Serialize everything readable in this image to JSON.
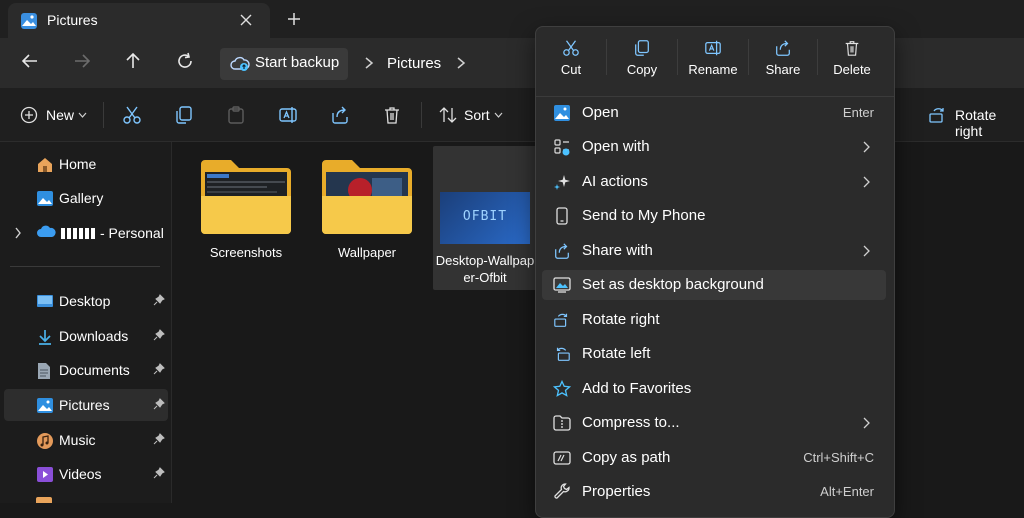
{
  "window": {
    "tab_title": "Pictures",
    "new_tab_symbol": "+"
  },
  "address": {
    "breadcrumbs": [
      "Start backup",
      "Pictures"
    ]
  },
  "toolbar": {
    "new_label": "New",
    "sort_label": "Sort",
    "rotate_right_label": "Rotate right"
  },
  "sidebar": {
    "top_items": [
      {
        "label": "Home",
        "icon": "home-icon"
      },
      {
        "label": "Gallery",
        "icon": "gallery-icon"
      },
      {
        "label": "- Personal",
        "icon": "onedrive-icon"
      }
    ],
    "pinned_items": [
      {
        "label": "Desktop",
        "icon": "desktop-icon",
        "pinned": true
      },
      {
        "label": "Downloads",
        "icon": "downloads-icon",
        "pinned": true
      },
      {
        "label": "Documents",
        "icon": "documents-icon",
        "pinned": true
      },
      {
        "label": "Pictures",
        "icon": "pictures-icon",
        "pinned": true,
        "selected": true
      },
      {
        "label": "Music",
        "icon": "music-icon",
        "pinned": true
      },
      {
        "label": "Videos",
        "icon": "videos-icon",
        "pinned": true
      }
    ]
  },
  "files": [
    {
      "name": "Screenshots",
      "type": "folder"
    },
    {
      "name": "Wallpaper",
      "type": "folder"
    },
    {
      "name": "Desktop-Wallpaper-Ofbit",
      "type": "image",
      "selected": true,
      "thumbnail_text": "OFBIT"
    }
  ],
  "context_menu": {
    "top_actions": [
      {
        "label": "Cut",
        "icon": "cut-icon"
      },
      {
        "label": "Copy",
        "icon": "copy-icon"
      },
      {
        "label": "Rename",
        "icon": "rename-icon"
      },
      {
        "label": "Share",
        "icon": "share-icon"
      },
      {
        "label": "Delete",
        "icon": "delete-icon"
      }
    ],
    "items": [
      {
        "label": "Open",
        "shortcut": "Enter",
        "icon": "open-image-icon"
      },
      {
        "label": "Open with",
        "submenu": true,
        "icon": "open-with-icon"
      },
      {
        "label": "AI actions",
        "submenu": true,
        "icon": "ai-sparkle-icon"
      },
      {
        "label": "Send to My Phone",
        "icon": "phone-icon"
      },
      {
        "label": "Share with",
        "submenu": true,
        "icon": "share-with-icon"
      },
      {
        "label": "Set as desktop background",
        "icon": "desktop-background-icon",
        "highlighted": true
      },
      {
        "label": "Rotate right",
        "icon": "rotate-right-icon"
      },
      {
        "label": "Rotate left",
        "icon": "rotate-left-icon"
      },
      {
        "label": "Add to Favorites",
        "icon": "star-icon"
      },
      {
        "label": "Compress to...",
        "submenu": true,
        "icon": "compress-icon"
      },
      {
        "label": "Copy as path",
        "shortcut": "Ctrl+Shift+C",
        "icon": "copy-path-icon"
      },
      {
        "label": "Properties",
        "shortcut": "Alt+Enter",
        "icon": "properties-icon"
      }
    ]
  },
  "colors": {
    "accent": "#4cc2ff",
    "folder": "#f3c242",
    "menu_bg": "#2b2b2b",
    "window_bg": "#191919"
  }
}
